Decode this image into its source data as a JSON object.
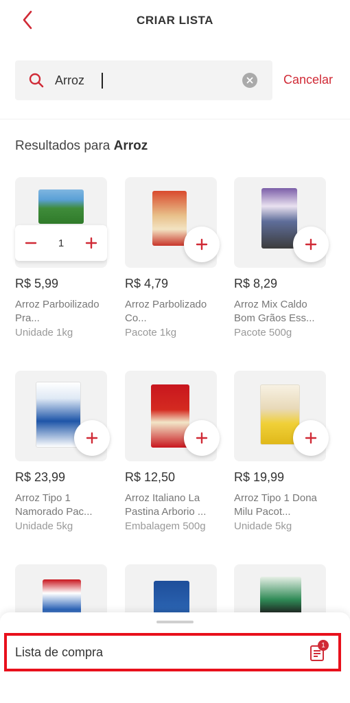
{
  "header": {
    "title": "CRIAR LISTA"
  },
  "search": {
    "value": "Arroz",
    "cancel_label": "Cancelar"
  },
  "results": {
    "prefix": "Resultados para",
    "term": "Arroz"
  },
  "products": [
    {
      "price": "R$ 5,99",
      "name": "Arroz Parboilizado Pra...",
      "unit": "Unidade 1kg",
      "quantity": "1"
    },
    {
      "price": "R$ 4,79",
      "name": "Arroz Parbolizado Co...",
      "unit": "Pacote 1kg"
    },
    {
      "price": "R$ 8,29",
      "name": "Arroz Mix Caldo Bom Grãos Ess...",
      "unit": "Pacote 500g"
    },
    {
      "price": "R$ 23,99",
      "name": "Arroz Tipo 1 Namorado Pac...",
      "unit": "Unidade 5kg"
    },
    {
      "price": "R$ 12,50",
      "name": "Arroz Italiano La Pastina Arborio ...",
      "unit": "Embalagem 500g"
    },
    {
      "price": "R$ 19,99",
      "name": "Arroz Tipo 1 Dona Milu Pacot...",
      "unit": "Unidade 5kg"
    }
  ],
  "bottom_sheet": {
    "label": "Lista de compra",
    "badge_count": "1"
  },
  "colors": {
    "accent": "#d02a36",
    "highlight": "#e8101c"
  }
}
